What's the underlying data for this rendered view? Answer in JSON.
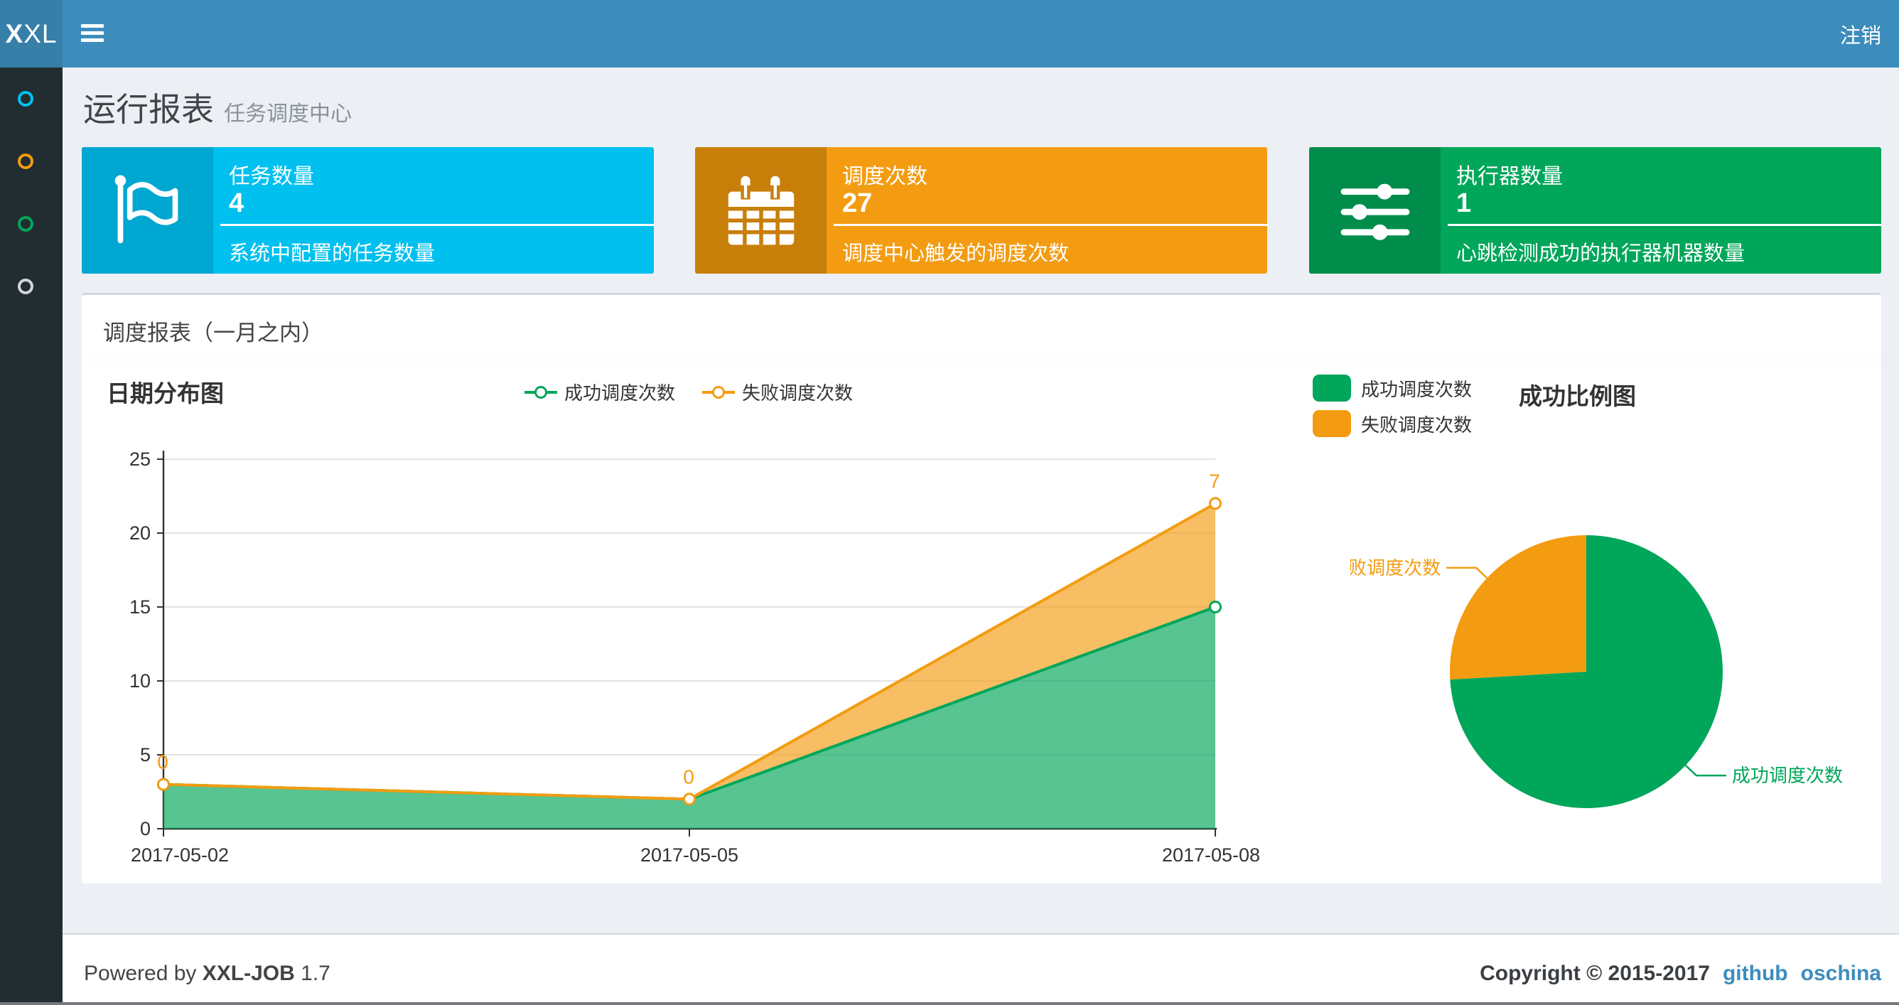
{
  "header": {
    "logo": "XXL",
    "logout": "注销"
  },
  "sidebar": {
    "items": [
      {
        "name": "run-report",
        "color": "#00c0ef"
      },
      {
        "name": "job-manage",
        "color": "#f39c12"
      },
      {
        "name": "job-log",
        "color": "#00a65a"
      },
      {
        "name": "executor-manage",
        "color": "#d2d6de"
      }
    ]
  },
  "page": {
    "title": "运行报表",
    "subtitle": "任务调度中心"
  },
  "cards": [
    {
      "title": "任务数量",
      "value": "4",
      "desc": "系统中配置的任务数量",
      "bg": "#00c0ef",
      "icon_bg": "#00a7d0",
      "icon": "flag-icon"
    },
    {
      "title": "调度次数",
      "value": "27",
      "desc": "调度中心触发的调度次数",
      "bg": "#f39c12",
      "icon_bg": "#c87f0a",
      "icon": "calendar-icon"
    },
    {
      "title": "执行器数量",
      "value": "1",
      "desc": "心跳检测成功的执行器机器数量",
      "bg": "#00a65a",
      "icon_bg": "#008d4c",
      "icon": "sliders-icon"
    }
  ],
  "panel": {
    "title": "调度报表（一月之内）"
  },
  "chart_data": [
    {
      "type": "area",
      "title": "日期分布图",
      "x": [
        "2017-05-02",
        "2017-05-05",
        "2017-05-08"
      ],
      "series": [
        {
          "name": "成功调度次数",
          "values": [
            3,
            2,
            15
          ],
          "color": "#00a65a"
        },
        {
          "name": "失败调度次数",
          "values": [
            0,
            0,
            7
          ],
          "color": "#f39c12"
        }
      ],
      "stacked": true,
      "grid": true,
      "legend_position": "top-center",
      "ylim": [
        0,
        25
      ],
      "yticks": [
        0,
        5,
        10,
        15,
        20,
        25
      ],
      "point_labels": {
        "series": "失败调度次数",
        "values": [
          "0",
          "0",
          "7"
        ]
      }
    },
    {
      "type": "pie",
      "title": "成功比例图",
      "legend_position": "top-left",
      "slices": [
        {
          "label": "成功调度次数",
          "value": 20,
          "color": "#00a65a"
        },
        {
          "label": "失败调度次数",
          "value": 7,
          "color": "#f39c12"
        }
      ]
    }
  ],
  "footer": {
    "powered_prefix": "Powered by",
    "product": "XXL-JOB",
    "version": "1.7",
    "copyright": "Copyright © 2015-2017",
    "links": [
      "github",
      "oschina"
    ]
  }
}
